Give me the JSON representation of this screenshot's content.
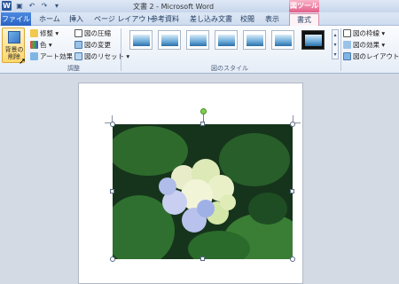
{
  "titlebar": {
    "app_icon": "W",
    "title": "文書 2 - Microsoft Word",
    "context_group": "図ツール",
    "qat_icons": [
      "save-icon",
      "undo-icon",
      "redo-icon",
      "customize-icon"
    ],
    "qat_glyphs": [
      "▣",
      "↶",
      "↷",
      "▾"
    ]
  },
  "tabs": [
    "ファイル",
    "ホーム",
    "挿入",
    "ページ レイアウト",
    "参考資料",
    "差し込み文書",
    "校閲",
    "表示",
    "書式"
  ],
  "ribbon": {
    "remove_background": "背景の\n削除",
    "adjust": {
      "items": [
        "修整 ▾",
        "色 ▾",
        "アート効果 ▾"
      ],
      "items2": [
        "図の圧縮",
        "図の変更",
        "図のリセット ▾"
      ],
      "label": "調整"
    },
    "styles": {
      "label": "図のスタイル"
    },
    "right_items": [
      "図の枠線 ▾",
      "図の効果 ▾",
      "図のレイアウト ▾"
    ]
  },
  "colors": {
    "accent_file_tab": "#2a63c4",
    "context_tab": "#e35f8a",
    "selected_button": "#ffd86b"
  }
}
